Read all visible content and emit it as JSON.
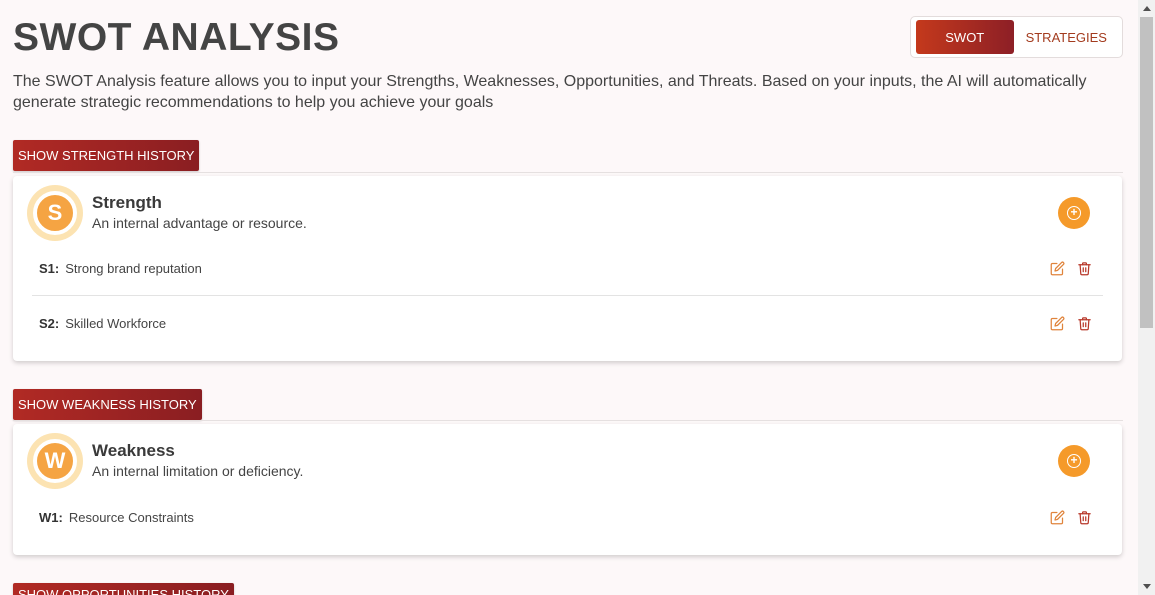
{
  "header": {
    "title": "SWOT ANALYSIS",
    "description": "The SWOT Analysis feature allows you to input your Strengths, Weaknesses, Opportunities, and Threats. Based on your inputs, the AI will automatically generate strategic recommendations to help you achieve your goals"
  },
  "tabs": [
    {
      "label": "SWOT",
      "active": true
    },
    {
      "label": "STRATEGIES",
      "active": false
    }
  ],
  "sections": {
    "strength": {
      "history_button": "SHOW STRENGTH HISTORY",
      "badge_letter": "S",
      "title": "Strength",
      "subtitle": "An internal advantage or resource.",
      "items": [
        {
          "code": "S1:",
          "text": "Strong brand reputation"
        },
        {
          "code": "S2:",
          "text": "Skilled Workforce"
        }
      ]
    },
    "weakness": {
      "history_button": "SHOW WEAKNESS HISTORY",
      "badge_letter": "W",
      "title": "Weakness",
      "subtitle": "An internal limitation or deficiency.",
      "items": [
        {
          "code": "W1:",
          "text": "Resource Constraints"
        }
      ]
    },
    "opportunities": {
      "history_button": "SHOW OPPORTUNITIES HISTORY"
    }
  },
  "icons": {
    "add": "plus-circle-icon",
    "edit": "edit-icon",
    "delete": "trash-icon"
  },
  "colors": {
    "brand_red": "#8d1f26",
    "accent_orange": "#f59a2a",
    "badge_yellow": "#fce3b2"
  }
}
